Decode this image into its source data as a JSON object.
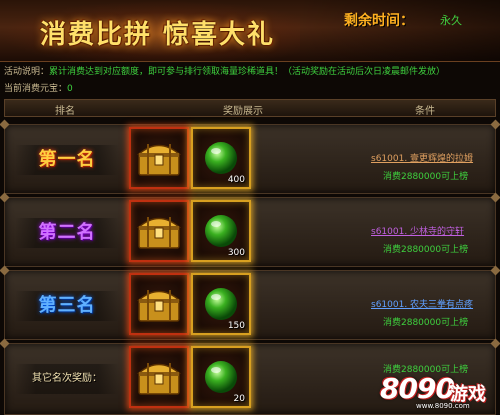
{
  "banner": {
    "title": "消费比拼  惊喜大礼",
    "time_label": "剩余时间：",
    "time_value": "永久"
  },
  "info": {
    "desc_label": "活动说明：",
    "desc_text": "累计消费达到对应额度，即可参与排行领取海量珍稀道具！（活动奖励在活动后次日凌晨邮件发放）",
    "current_label": "当前消费元宝：",
    "current_value": "0"
  },
  "table": {
    "headers": [
      "排名",
      "奖励展示",
      "条件"
    ],
    "rows": [
      {
        "rank": "第一名",
        "rank_color": "#ffcf40",
        "orb_qty": "400",
        "cond_title": "s61001. 壹更辉煌的拉姆",
        "cond_req": "消费2880000可上榜"
      },
      {
        "rank": "第二名",
        "rank_color": "#d070ff",
        "orb_qty": "300",
        "cond_title": "s61001. 少林寺的守轩",
        "cond_req": "消费2880000可上榜"
      },
      {
        "rank": "第三名",
        "rank_color": "#60b0ff",
        "orb_qty": "150",
        "cond_title": "s61001. 农夫三拳有点疼",
        "cond_req": "消费2880000可上榜"
      },
      {
        "rank": "其它名次奖励：",
        "rank_color": "#f0e0b0",
        "orb_qty": "20",
        "cond_title": "",
        "cond_req": "消费2880000可上榜"
      }
    ]
  },
  "watermark": {
    "number": "8090",
    "text": "游戏",
    "url": "www.8090.com"
  }
}
